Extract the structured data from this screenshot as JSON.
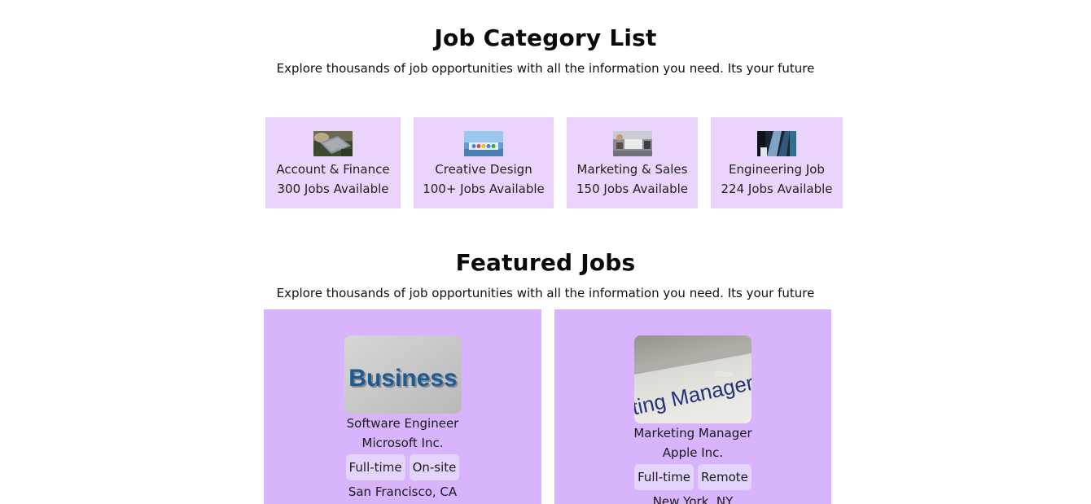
{
  "category_section": {
    "title": "Job Category List",
    "subtitle": "Explore thousands of job opportunities with all the information you need. Its your future"
  },
  "categories": [
    {
      "name": "Account & Finance",
      "count": "300 Jobs Available",
      "image": "laptop-image"
    },
    {
      "name": "Creative Design",
      "count": "100+ Jobs Available",
      "image": "google-sign-image"
    },
    {
      "name": "Marketing & Sales",
      "count": "150 Jobs Available",
      "image": "meeting-image"
    },
    {
      "name": "Engineering Job",
      "count": "224 Jobs Available",
      "image": "city-image"
    }
  ],
  "featured_section": {
    "title": "Featured Jobs",
    "subtitle": "Explore thousands of job opportunities with all the information you need. Its your future"
  },
  "jobs": [
    {
      "image_text": "Business",
      "title": "Software Engineer",
      "company": "Microsoft Inc.",
      "tags": [
        "Full-time",
        "On-site"
      ],
      "location": "San Francisco, CA"
    },
    {
      "image_text": "ting Manager",
      "watermark": "iStock",
      "title": "Marketing Manager",
      "company": "Apple Inc.",
      "tags": [
        "Full-time",
        "Remote"
      ],
      "location": "New York, NY"
    }
  ],
  "colors": {
    "category_card_bg": "#ead4fc",
    "job_card_bg": "#d7b4fb",
    "tag_bg": "#e3d4fc"
  }
}
